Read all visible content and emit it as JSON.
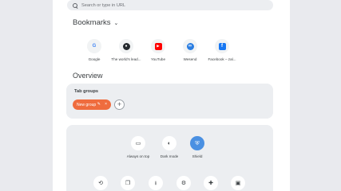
{
  "search": {
    "placeholder": "Search or type in URL",
    "icon": "search-icon"
  },
  "bookmarks": {
    "title": "Bookmarks",
    "items": [
      {
        "label": "Google",
        "icon": "google-icon",
        "glyph": "G",
        "color": "#4285f4"
      },
      {
        "label": "The world's lead...",
        "icon": "github-icon",
        "glyph": "●",
        "color": "#24292e"
      },
      {
        "label": "YouTube",
        "icon": "youtube-icon",
        "glyph": "▶",
        "color": "#ff0000"
      },
      {
        "label": "Wesend",
        "icon": "wesend-icon",
        "glyph": "∞",
        "color": "#2a7de1"
      },
      {
        "label": "Facebook – zal...",
        "icon": "facebook-icon",
        "glyph": "f",
        "color": "#1877f2"
      }
    ]
  },
  "overview": {
    "title": "Overview",
    "tab_groups": {
      "title": "Tab groups",
      "new_group_label": "New group",
      "new_group_color": "#ef6c3e",
      "add_label": "+"
    }
  },
  "tools": {
    "items": [
      {
        "label": "Always on top",
        "icon": "always-on-top-icon",
        "glyph": "▭"
      },
      {
        "label": "Dark mode",
        "icon": "dark-mode-icon",
        "glyph": "◐"
      },
      {
        "label": "Shield",
        "icon": "shield-icon",
        "glyph": "⛨",
        "active_color": "#4a90e2"
      }
    ],
    "bottom_icons": [
      {
        "icon": "history-icon",
        "glyph": "⟲"
      },
      {
        "icon": "bookmarks-icon",
        "glyph": "❐"
      },
      {
        "icon": "downloads-icon",
        "glyph": "⭳"
      },
      {
        "icon": "settings-icon",
        "glyph": "⚙"
      },
      {
        "icon": "extensions-icon",
        "glyph": "✚"
      },
      {
        "icon": "document-icon",
        "glyph": "▣"
      }
    ]
  }
}
